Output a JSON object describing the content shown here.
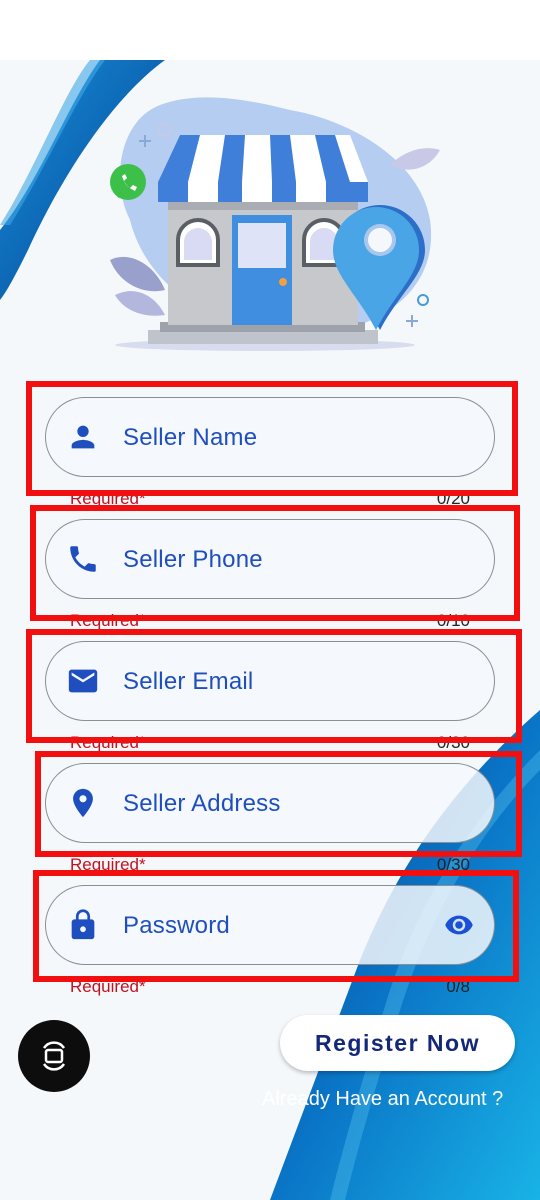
{
  "form": {
    "fields": [
      {
        "label": "Seller Name",
        "helper": "Required*",
        "counter": "0/20",
        "icon": "person-icon"
      },
      {
        "label": "Seller Phone",
        "helper": "Required*",
        "counter": "0/10",
        "icon": "phone-icon"
      },
      {
        "label": "Seller Email",
        "helper": "Required*",
        "counter": "0/30",
        "icon": "mail-icon"
      },
      {
        "label": "Seller Address",
        "helper": "Required*",
        "counter": "0/30",
        "icon": "location-pin-icon"
      },
      {
        "label": "Password",
        "helper": "Required*",
        "counter": "0/8",
        "icon": "lock-icon",
        "trailing_icon": "eye-icon"
      }
    ]
  },
  "actions": {
    "register_label": "Register Now",
    "login_link": "Already Have an Account ?"
  },
  "colors": {
    "accent": "#1f4fbf",
    "button_text": "#14287a",
    "error": "#c1121f",
    "highlight": "#f20f10",
    "wave": "#0b73c4"
  }
}
